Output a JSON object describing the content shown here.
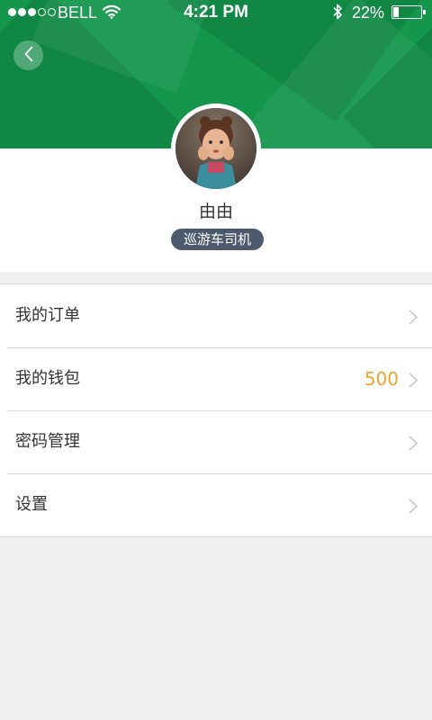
{
  "status_bar": {
    "carrier": "BELL",
    "time": "4:21 PM",
    "battery_percent": "22%",
    "battery_level": 0.22,
    "signal_strength": 3,
    "signal_max": 5
  },
  "header": {
    "back_icon": "chevron-left-icon",
    "background_color": "#14964c"
  },
  "profile": {
    "name": "由由",
    "role": "巡游车司机",
    "role_badge_color": "#4d5a6e"
  },
  "menu": {
    "items": [
      {
        "label": "我的订单",
        "value": ""
      },
      {
        "label": "我的钱包",
        "value": "500",
        "value_color": "#f0a42a"
      },
      {
        "label": "密码管理",
        "value": ""
      },
      {
        "label": "设置",
        "value": ""
      }
    ],
    "chevron_icon": "chevron-right-icon"
  }
}
